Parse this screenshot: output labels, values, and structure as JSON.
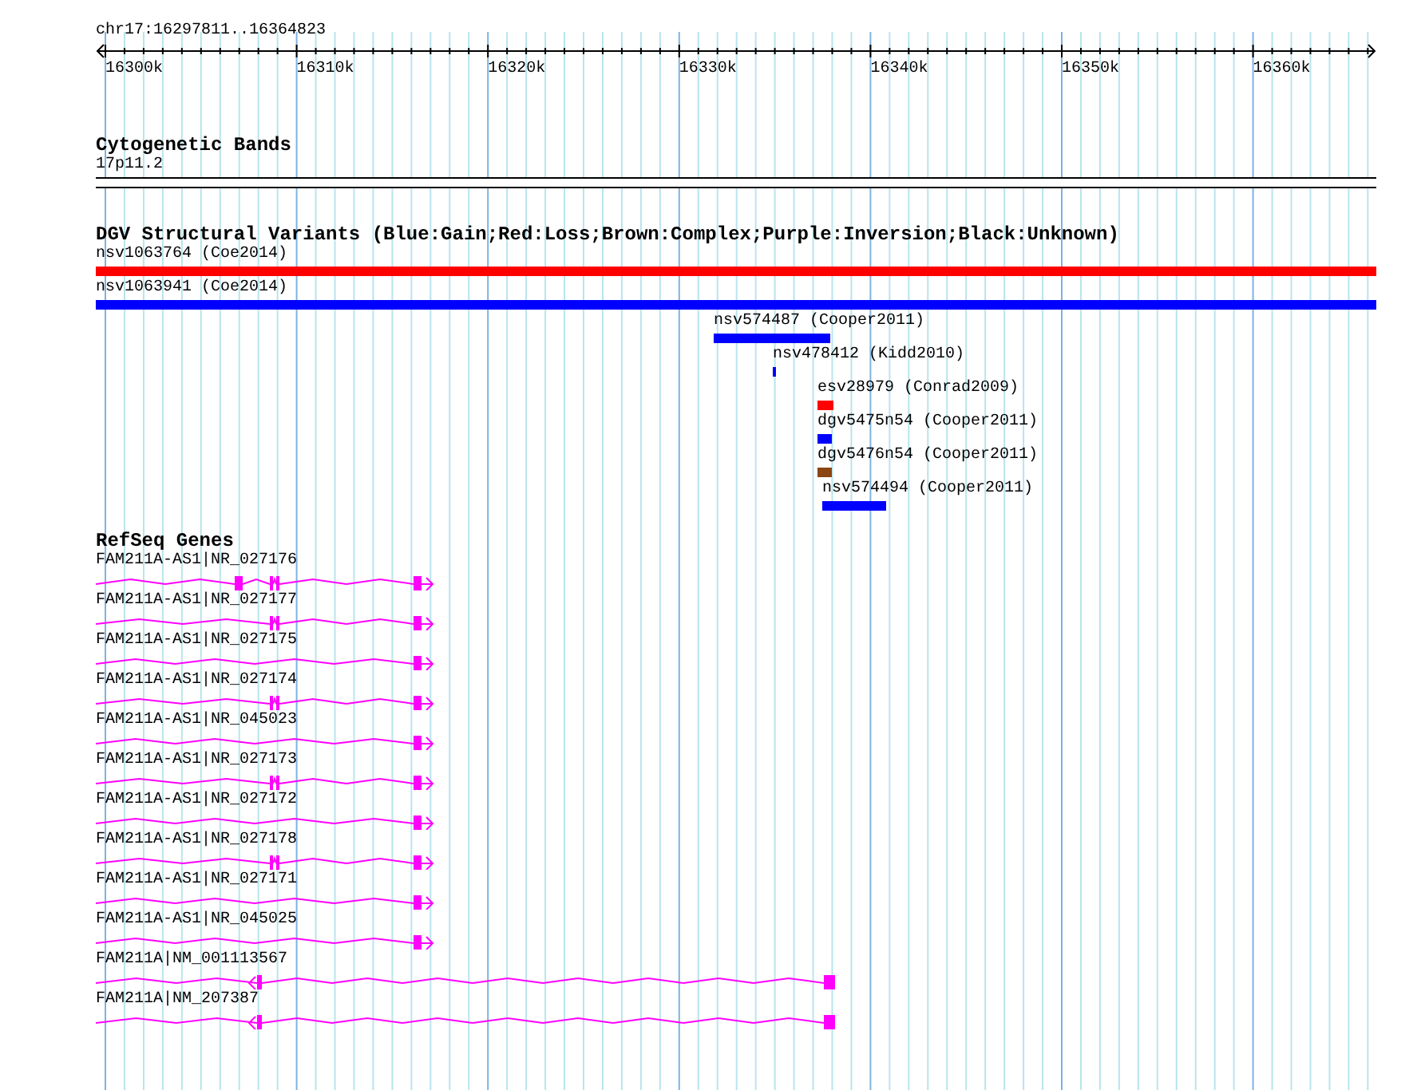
{
  "ruler": {
    "region": "chr17:16297811..16364823",
    "ticks": [
      "16300k",
      "16310k",
      "16320k",
      "16330k",
      "16340k",
      "16350k",
      "16360k"
    ]
  },
  "tracks": [
    {
      "kind": "bands",
      "title": "Cytogenetic Bands",
      "features": [
        {
          "label": "17p11.2"
        }
      ]
    },
    {
      "kind": "variants",
      "title": "DGV Structural Variants (Blue:Gain;Red:Loss;Brown:Complex;Purple:Inversion;Black:Unknown)",
      "features": [
        {
          "label": "nsv1063764 (Coe2014)",
          "color": "#ff0000"
        },
        {
          "label": "nsv1063941 (Coe2014)",
          "color": "#0000ff"
        },
        {
          "label": "nsv574487 (Cooper2011)",
          "color": "#0000ff"
        },
        {
          "label": "nsv478412 (Kidd2010)",
          "color": "#0000ff"
        },
        {
          "label": "esv28979 (Conrad2009)",
          "color": "#ff0000"
        },
        {
          "label": "dgv5475n54 (Cooper2011)",
          "color": "#0000ff"
        },
        {
          "label": "dgv5476n54 (Cooper2011)",
          "color": "#8b4513"
        },
        {
          "label": "nsv574494 (Cooper2011)",
          "color": "#0000ff"
        }
      ]
    },
    {
      "kind": "genes",
      "title": "RefSeq Genes",
      "features": [
        {
          "label": "FAM211A-AS1|NR_027176",
          "kind": "forward"
        },
        {
          "label": "FAM211A-AS1|NR_027177",
          "kind": "forward"
        },
        {
          "label": "FAM211A-AS1|NR_027175",
          "kind": "forward"
        },
        {
          "label": "FAM211A-AS1|NR_027174",
          "kind": "forward"
        },
        {
          "label": "FAM211A-AS1|NR_045023",
          "kind": "forward"
        },
        {
          "label": "FAM211A-AS1|NR_027173",
          "kind": "forward"
        },
        {
          "label": "FAM211A-AS1|NR_027172",
          "kind": "forward"
        },
        {
          "label": "FAM211A-AS1|NR_027178",
          "kind": "forward"
        },
        {
          "label": "FAM211A-AS1|NR_027171",
          "kind": "forward"
        },
        {
          "label": "FAM211A-AS1|NR_045025",
          "kind": "forward"
        },
        {
          "label": "FAM211A|NM_001113567",
          "kind": "reverse"
        },
        {
          "label": "FAM211A|NM_207387",
          "kind": "reverse"
        }
      ]
    }
  ]
}
